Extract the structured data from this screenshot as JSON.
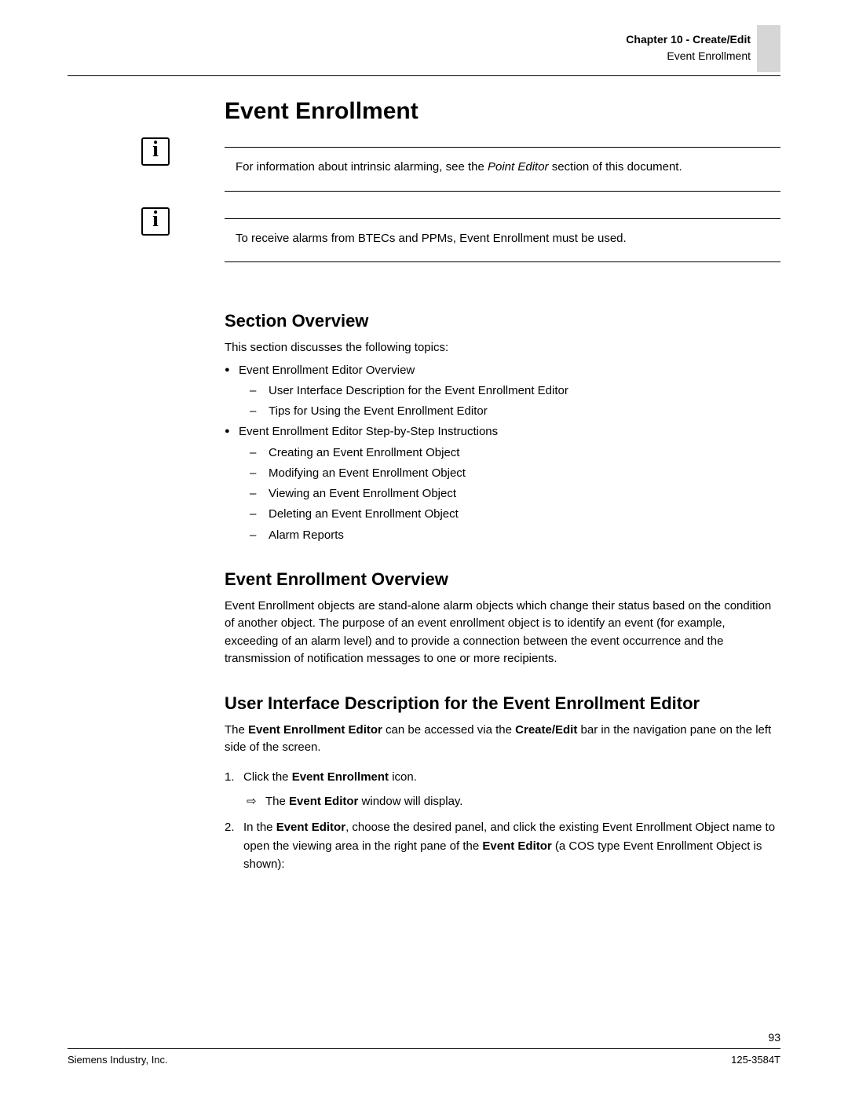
{
  "header": {
    "chapter": "Chapter 10 - Create/Edit",
    "section": "Event Enrollment"
  },
  "page_title": "Event Enrollment",
  "info_notes": {
    "note1_prefix": "For information about intrinsic alarming, see the ",
    "note1_italic": "Point Editor",
    "note1_suffix": " section of this document.",
    "note2": "To receive alarms from BTECs and PPMs, Event Enrollment must be used."
  },
  "sections": {
    "overview_h": "Section Overview",
    "overview_intro": "This section discusses the following topics:",
    "topics": {
      "t1": "Event Enrollment Editor Overview",
      "t1_sub": {
        "s1": "User Interface Description for the Event Enrollment Editor",
        "s2": "Tips for Using the Event Enrollment Editor"
      },
      "t2": "Event Enrollment Editor Step-by-Step Instructions",
      "t2_sub": {
        "s1": "Creating an Event Enrollment Object",
        "s2": "Modifying an Event Enrollment Object",
        "s3": "Viewing an Event Enrollment Object",
        "s4": "Deleting an Event Enrollment Object",
        "s5": "Alarm Reports"
      }
    },
    "enroll_overview_h": "Event Enrollment Overview",
    "enroll_overview_body": "Event Enrollment objects are stand-alone alarm objects which change their status based on the condition of another object. The purpose of an event enrollment object is to identify an event (for example, exceeding of an alarm level) and to provide a connection between the event occurrence and the transmission of notification messages to one or more recipients.",
    "ui_desc_h": "User Interface Description for the Event Enrollment Editor",
    "ui_desc_intro_1": "The ",
    "ui_desc_intro_b1": "Event Enrollment Editor",
    "ui_desc_intro_2": " can be accessed via the ",
    "ui_desc_intro_b2": "Create/Edit",
    "ui_desc_intro_3": " bar in the navigation pane on the left side of the screen.",
    "steps": {
      "s1_a": "Click the ",
      "s1_b": "Event Enrollment",
      "s1_c": " icon.",
      "s1_sub_a": "The ",
      "s1_sub_b": "Event Editor",
      "s1_sub_c": " window will display.",
      "s2_a": "In the ",
      "s2_b1": "Event Editor",
      "s2_c": ", choose the desired panel, and click the existing Event Enrollment Object name to open the viewing area in the right pane of the ",
      "s2_b2": "Event Editor",
      "s2_d": " (a COS type Event Enrollment Object is shown):"
    }
  },
  "footer": {
    "page_number": "93",
    "left": "Siemens Industry, Inc.",
    "right": "125-3584T"
  }
}
